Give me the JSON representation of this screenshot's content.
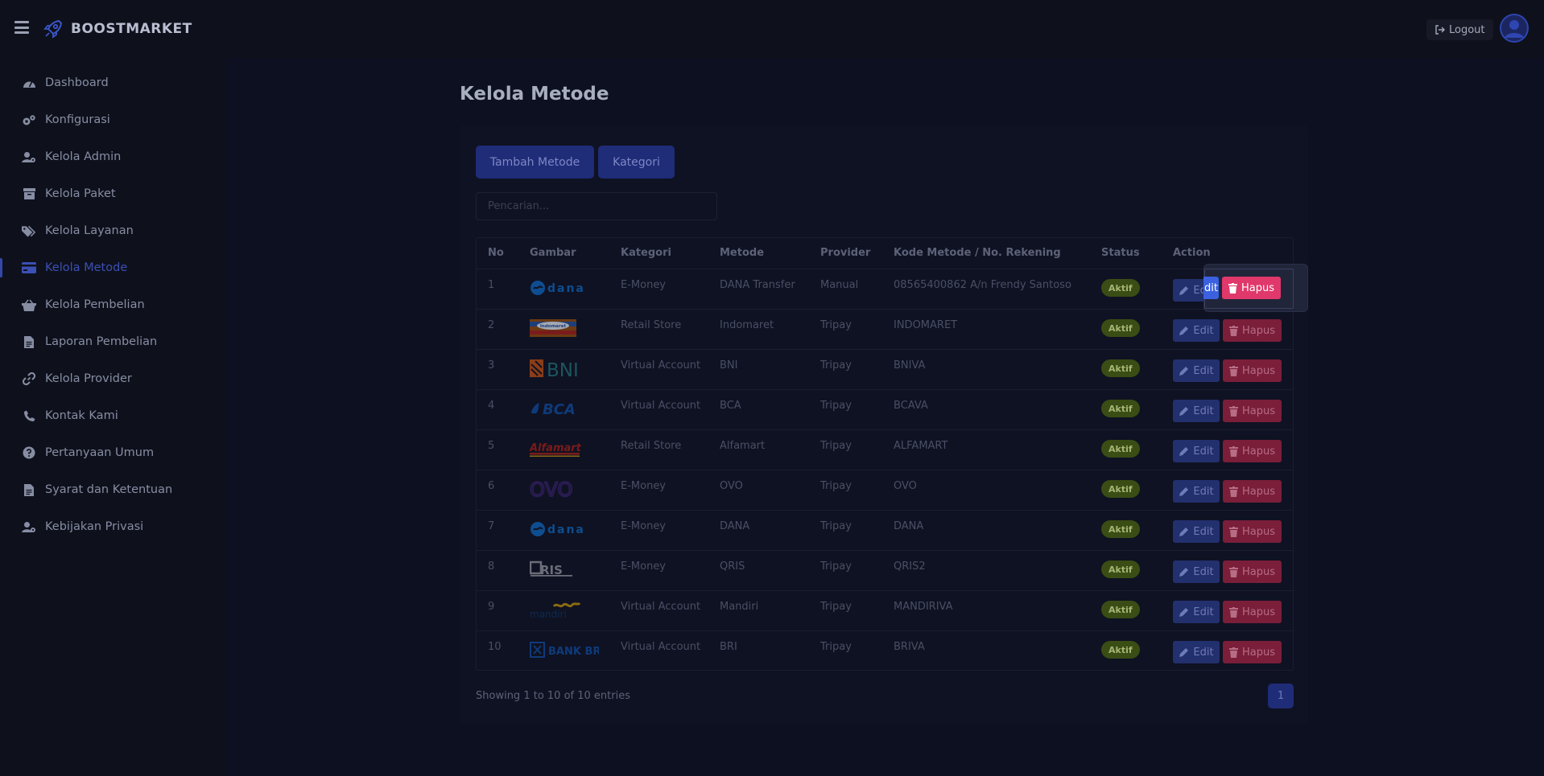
{
  "brand": {
    "name": "BOOSTMARKET"
  },
  "header": {
    "logout_label": "Logout"
  },
  "sidebar": {
    "items": [
      {
        "label": "Dashboard",
        "icon": "gauge-icon",
        "active": false
      },
      {
        "label": "Konfigurasi",
        "icon": "gears-icon",
        "active": false
      },
      {
        "label": "Kelola Admin",
        "icon": "user-cog-icon",
        "active": false
      },
      {
        "label": "Kelola Paket",
        "icon": "box-icon",
        "active": false
      },
      {
        "label": "Kelola Layanan",
        "icon": "tags-icon",
        "active": false
      },
      {
        "label": "Kelola Metode",
        "icon": "credit-card-icon",
        "active": true
      },
      {
        "label": "Kelola Pembelian",
        "icon": "basket-icon",
        "active": false
      },
      {
        "label": "Laporan Pembelian",
        "icon": "file-icon",
        "active": false
      },
      {
        "label": "Kelola Provider",
        "icon": "link-icon",
        "active": false
      },
      {
        "label": "Kontak Kami",
        "icon": "phone-icon",
        "active": false
      },
      {
        "label": "Pertanyaan Umum",
        "icon": "question-icon",
        "active": false
      },
      {
        "label": "Syarat dan Ketentuan",
        "icon": "file-icon",
        "active": false
      },
      {
        "label": "Kebijakan Privasi",
        "icon": "user-cog-icon",
        "active": false
      }
    ]
  },
  "main": {
    "title": "Kelola Metode",
    "add_button": "Tambah Metode",
    "category_button": "Kategori",
    "search_placeholder": "Pencarian...",
    "columns": [
      "No",
      "Gambar",
      "Kategori",
      "Metode",
      "Provider",
      "Kode Metode / No. Rekening",
      "Status",
      "Action"
    ],
    "rows": [
      {
        "no": "1",
        "logo": "DANA",
        "kategori": "E-Money",
        "metode": "DANA Transfer",
        "provider": "Manual",
        "kode": "08565400862 A/n Frendy Santoso",
        "status": "Aktif"
      },
      {
        "no": "2",
        "logo": "Indomaret",
        "kategori": "Retail Store",
        "metode": "Indomaret",
        "provider": "Tripay",
        "kode": "INDOMARET",
        "status": "Aktif"
      },
      {
        "no": "3",
        "logo": "BNI",
        "kategori": "Virtual Account",
        "metode": "BNI",
        "provider": "Tripay",
        "kode": "BNIVA",
        "status": "Aktif"
      },
      {
        "no": "4",
        "logo": "BCA",
        "kategori": "Virtual Account",
        "metode": "BCA",
        "provider": "Tripay",
        "kode": "BCAVA",
        "status": "Aktif"
      },
      {
        "no": "5",
        "logo": "Alfamart",
        "kategori": "Retail Store",
        "metode": "Alfamart",
        "provider": "Tripay",
        "kode": "ALFAMART",
        "status": "Aktif"
      },
      {
        "no": "6",
        "logo": "OVO",
        "kategori": "E-Money",
        "metode": "OVO",
        "provider": "Tripay",
        "kode": "OVO",
        "status": "Aktif"
      },
      {
        "no": "7",
        "logo": "DANA",
        "kategori": "E-Money",
        "metode": "DANA",
        "provider": "Tripay",
        "kode": "DANA",
        "status": "Aktif"
      },
      {
        "no": "8",
        "logo": "QRIS",
        "kategori": "E-Money",
        "metode": "QRIS",
        "provider": "Tripay",
        "kode": "QRIS2",
        "status": "Aktif"
      },
      {
        "no": "9",
        "logo": "mandiri",
        "kategori": "Virtual Account",
        "metode": "Mandiri",
        "provider": "Tripay",
        "kode": "MANDIRIVA",
        "status": "Aktif"
      },
      {
        "no": "10",
        "logo": "BANK BRI",
        "kategori": "Virtual Account",
        "metode": "BRI",
        "provider": "Tripay",
        "kode": "BRIVA",
        "status": "Aktif"
      }
    ],
    "edit_label": "Edit",
    "delete_label": "Hapus",
    "highlight_edit_label": "dit",
    "footer_info": "Showing 1 to 10 of 10 entries",
    "current_page": "1"
  },
  "colors": {
    "accent": "#1f2c78",
    "danger": "#e0386b",
    "success": "#3a4d14",
    "background": "#0d1020"
  }
}
